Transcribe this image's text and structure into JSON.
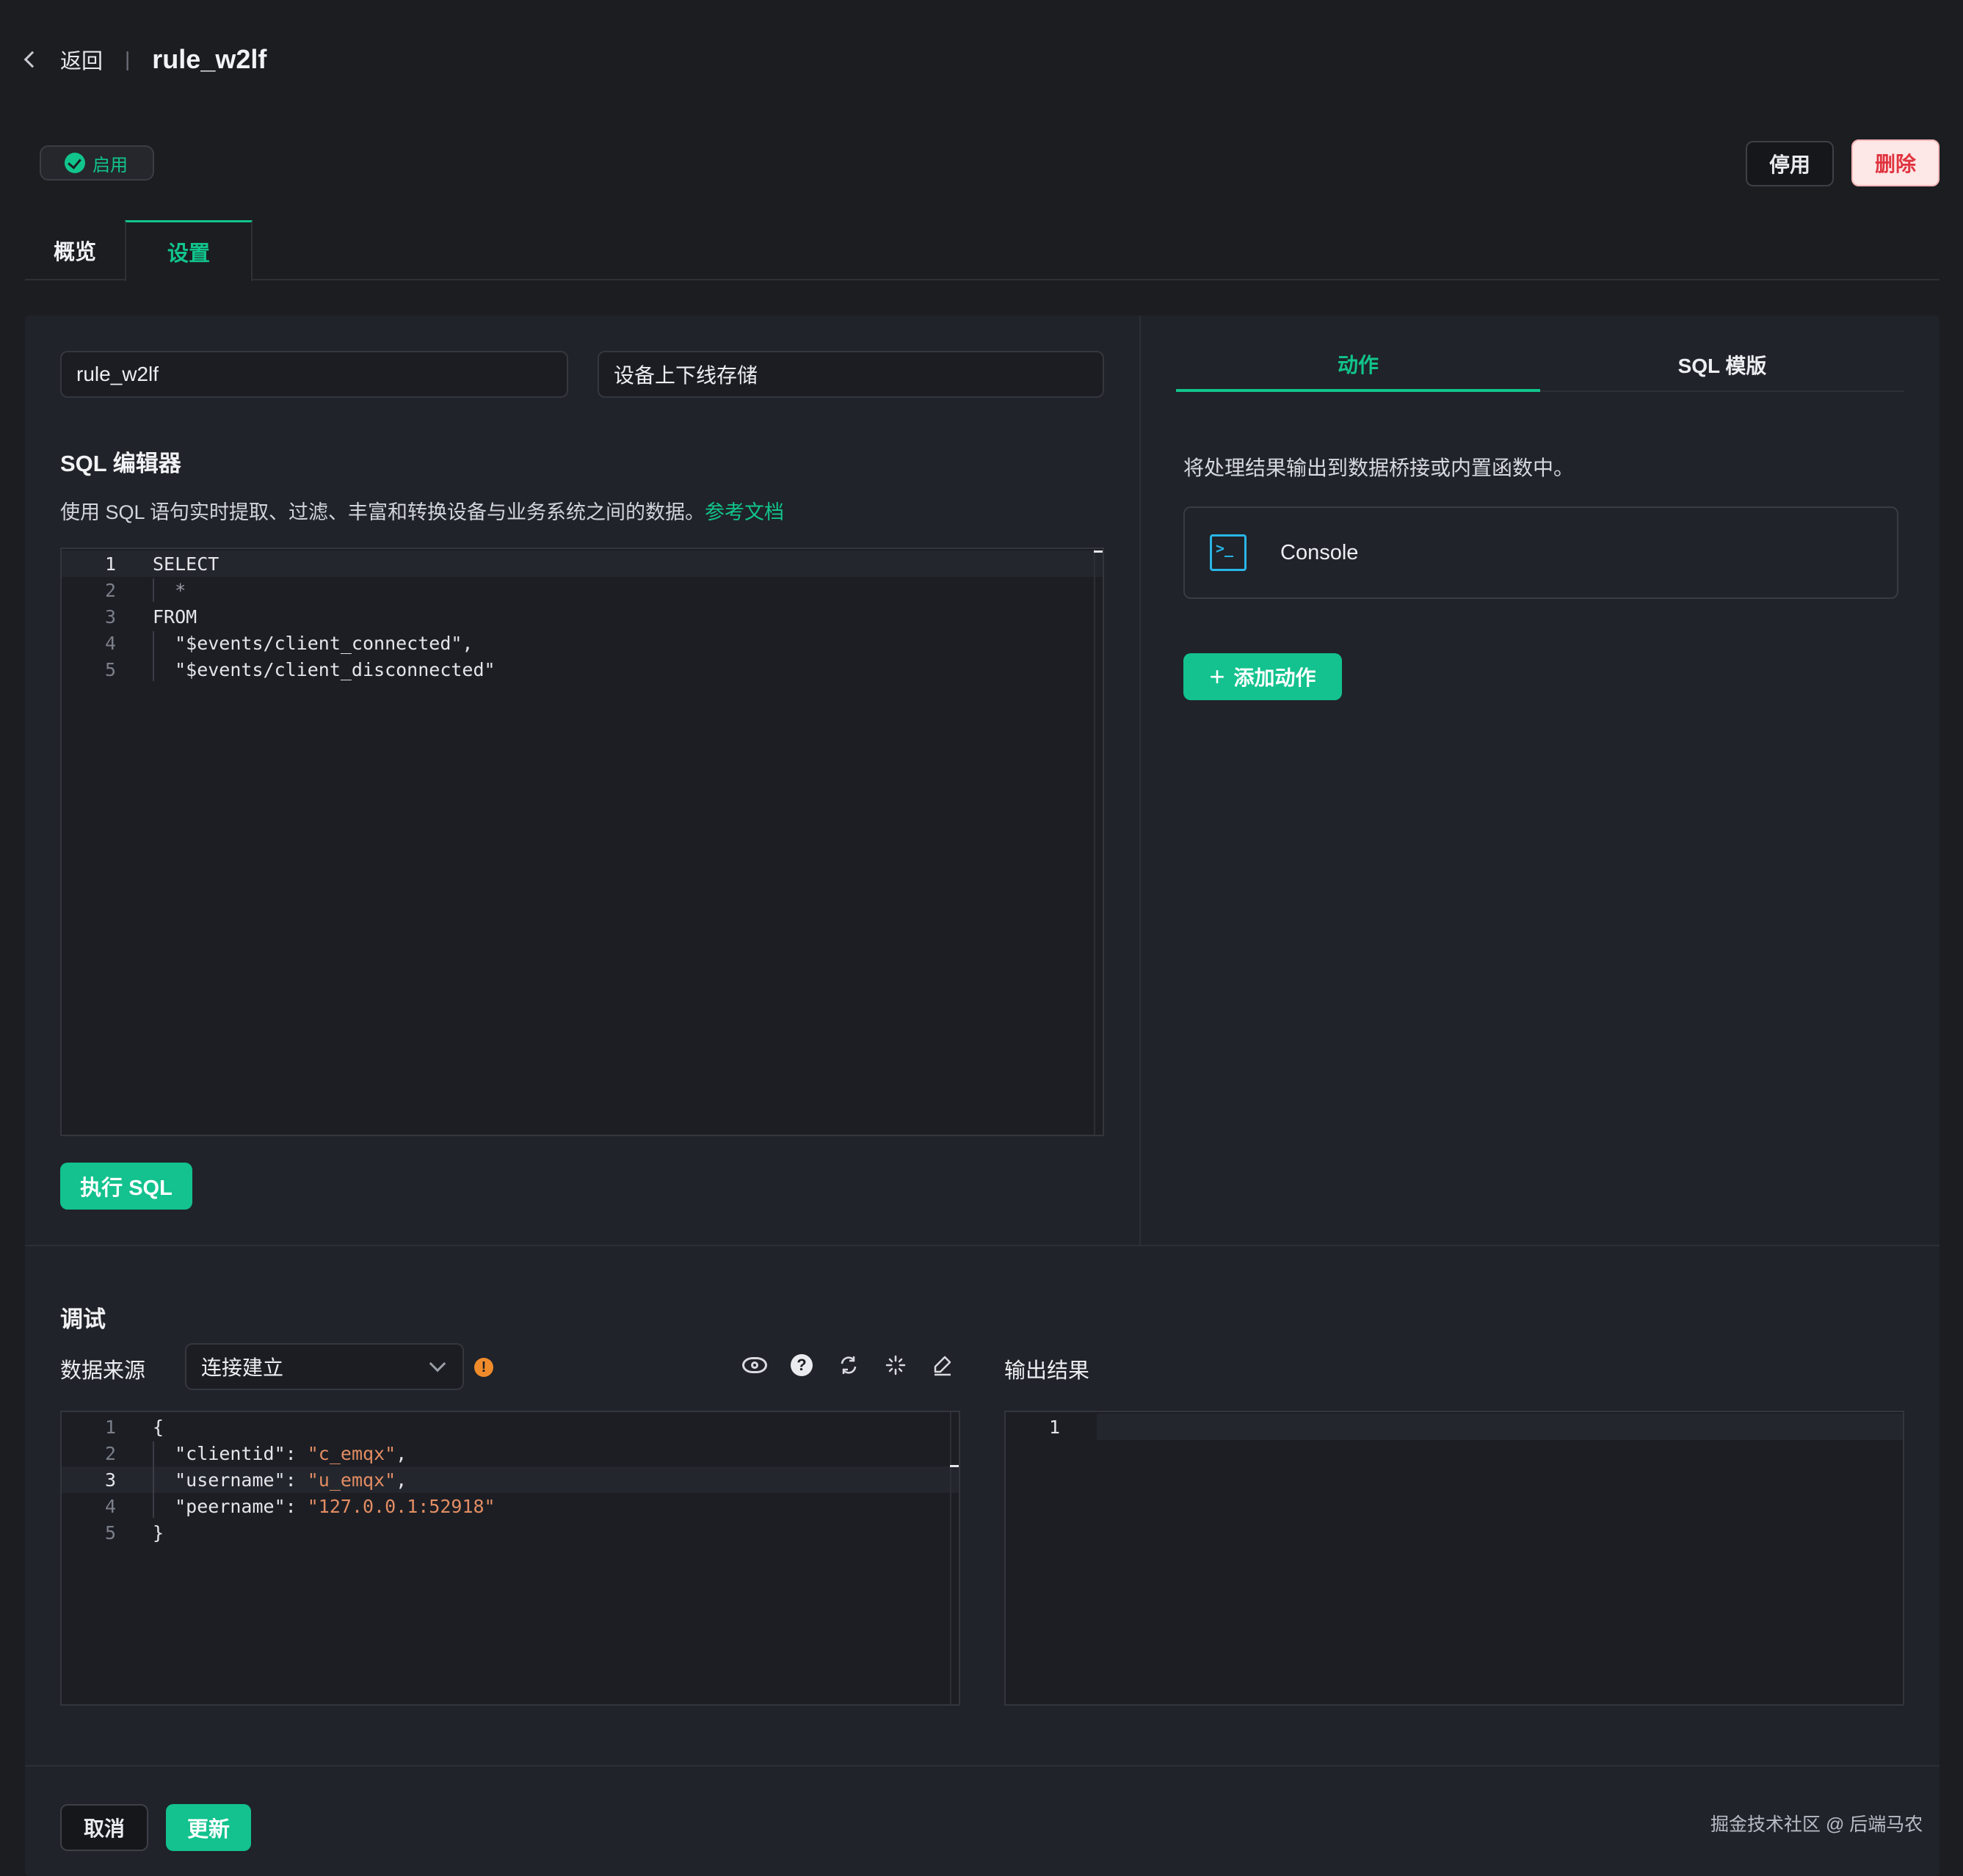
{
  "header": {
    "back_label": "返回",
    "separator": "|",
    "title": "rule_w2lf"
  },
  "status": {
    "label": "启用",
    "color": "#11c48b"
  },
  "actions": {
    "disable_label": "停用",
    "delete_label": "删除"
  },
  "tabs": [
    {
      "label": "概览"
    },
    {
      "label": "设置"
    }
  ],
  "form": {
    "name_value": "rule_w2lf",
    "description_value": "设备上下线存储"
  },
  "sql": {
    "title": "SQL 编辑器",
    "description": "使用 SQL 语句实时提取、过滤、丰富和转换设备与业务系统之间的数据。",
    "doc_link": "参考文档",
    "lines": [
      {
        "num": "1",
        "text": "SELECT"
      },
      {
        "num": "2",
        "text": "  *"
      },
      {
        "num": "3",
        "text": "FROM"
      },
      {
        "num": "4",
        "text": "  \"$events/client_connected\","
      },
      {
        "num": "5",
        "text": "  \"$events/client_disconnected\""
      }
    ],
    "run_label": "执行 SQL"
  },
  "right": {
    "tabs": [
      {
        "label": "动作"
      },
      {
        "label": "SQL 模版"
      }
    ],
    "description": "将处理结果输出到数据桥接或内置函数中。",
    "action_card": {
      "icon": "terminal-icon",
      "icon_glyph": ">_",
      "label": "Console"
    },
    "add_action_label": "添加动作",
    "add_action_glyph": "+"
  },
  "debug": {
    "title": "调试",
    "source_label": "数据来源",
    "source_selected": "连接建立",
    "warn_glyph": "!",
    "help_glyph": "?",
    "output_label": "输出结果",
    "input_lines": [
      {
        "num": "1",
        "key": "",
        "value": "",
        "text": "{"
      },
      {
        "num": "2",
        "key": "\"clientid\"",
        "value": "\"c_emqx\"",
        "tail": ","
      },
      {
        "num": "3",
        "key": "\"username\"",
        "value": "\"u_emqx\"",
        "tail": ","
      },
      {
        "num": "4",
        "key": "\"peername\"",
        "value": "\"127.0.0.1:52918\"",
        "tail": ""
      },
      {
        "num": "5",
        "key": "",
        "value": "",
        "text": "}"
      }
    ],
    "output_lines": [
      {
        "num": "1"
      }
    ]
  },
  "footer": {
    "cancel_label": "取消",
    "update_label": "更新",
    "watermark": "掘金技术社区 @ 后端马农"
  },
  "colors": {
    "accent": "#11c48b",
    "danger": "#e0343f",
    "keyword": "#f0487a",
    "string": "#e38d63"
  }
}
